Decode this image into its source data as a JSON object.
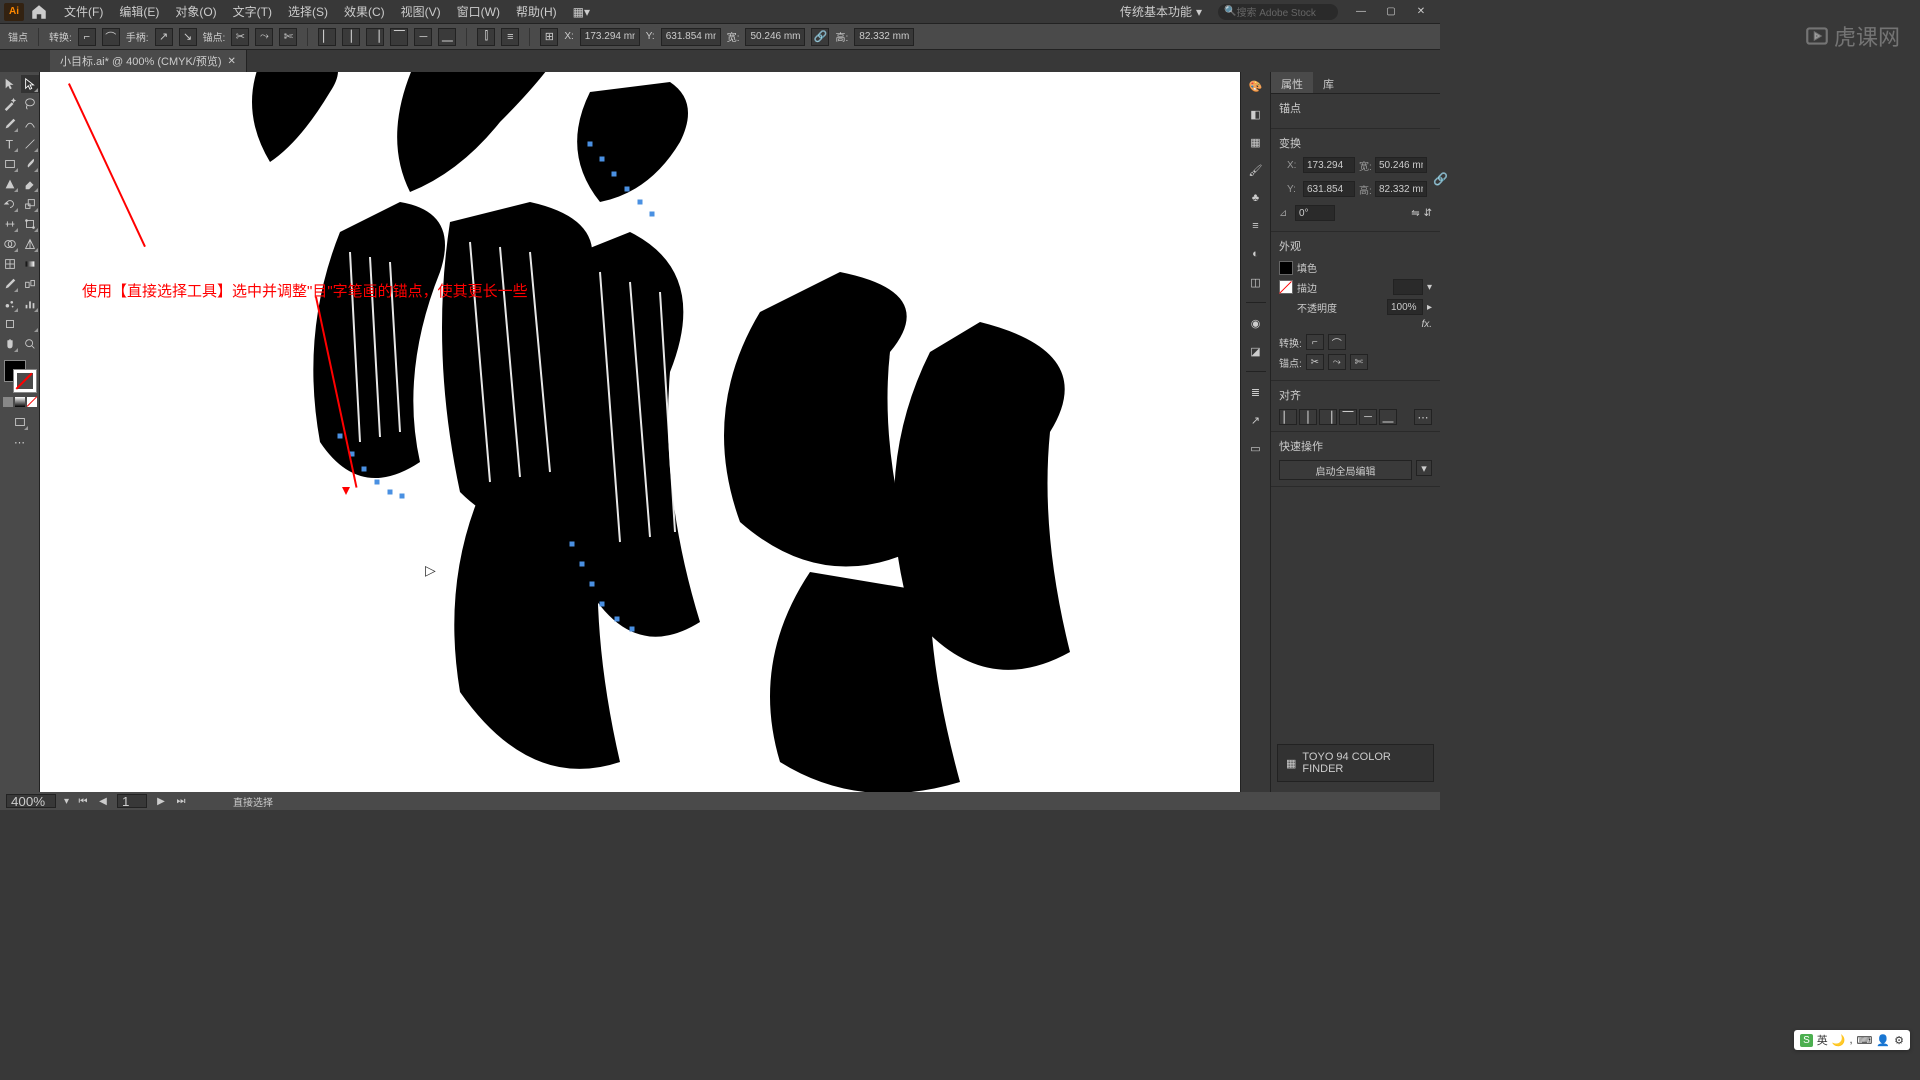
{
  "menubar": {
    "items": [
      "文件(F)",
      "编辑(E)",
      "对象(O)",
      "文字(T)",
      "选择(S)",
      "效果(C)",
      "视图(V)",
      "窗口(W)",
      "帮助(H)"
    ],
    "workspace": "传统基本功能",
    "search_placeholder": "搜索 Adobe Stock"
  },
  "controlbar": {
    "anchor_label": "锚点",
    "convert_label": "转换:",
    "handles_label": "手柄:",
    "anchors_label": "锚点:",
    "x_label": "X:",
    "x_value": "173.294 mm",
    "y_label": "Y:",
    "y_value": "631.854 mm",
    "w_label": "宽:",
    "w_value": "50.246 mm",
    "h_label": "高:",
    "h_value": "82.332 mm"
  },
  "tab": {
    "title": "小目标.ai* @ 400% (CMYK/预览)"
  },
  "annotation": {
    "text": "使用【直接选择工具】选中并调整\"目\"字笔画的锚点，使其更长一些"
  },
  "properties": {
    "tab_properties": "属性",
    "tab_libraries": "库",
    "section_anchor": "锚点",
    "section_transform": "变换",
    "x": "173.294",
    "y": "631.854",
    "w": "50.246 mm",
    "h": "82.332 mm",
    "angle": "0°",
    "section_appearance": "外观",
    "fill_label": "填色",
    "stroke_label": "描边",
    "opacity_label": "不透明度",
    "opacity_value": "100%",
    "rotate_label": "转换:",
    "anchor_edit_label": "锚点:",
    "section_align": "对齐",
    "section_quick": "快速操作",
    "action_global_edit": "启动全局编辑",
    "color_finder": "TOYO 94 COLOR FINDER"
  },
  "statusbar": {
    "zoom": "400%",
    "page": "1",
    "tool": "直接选择"
  },
  "ime": {
    "text": "英"
  },
  "watermark": {
    "text": "虎课网"
  }
}
